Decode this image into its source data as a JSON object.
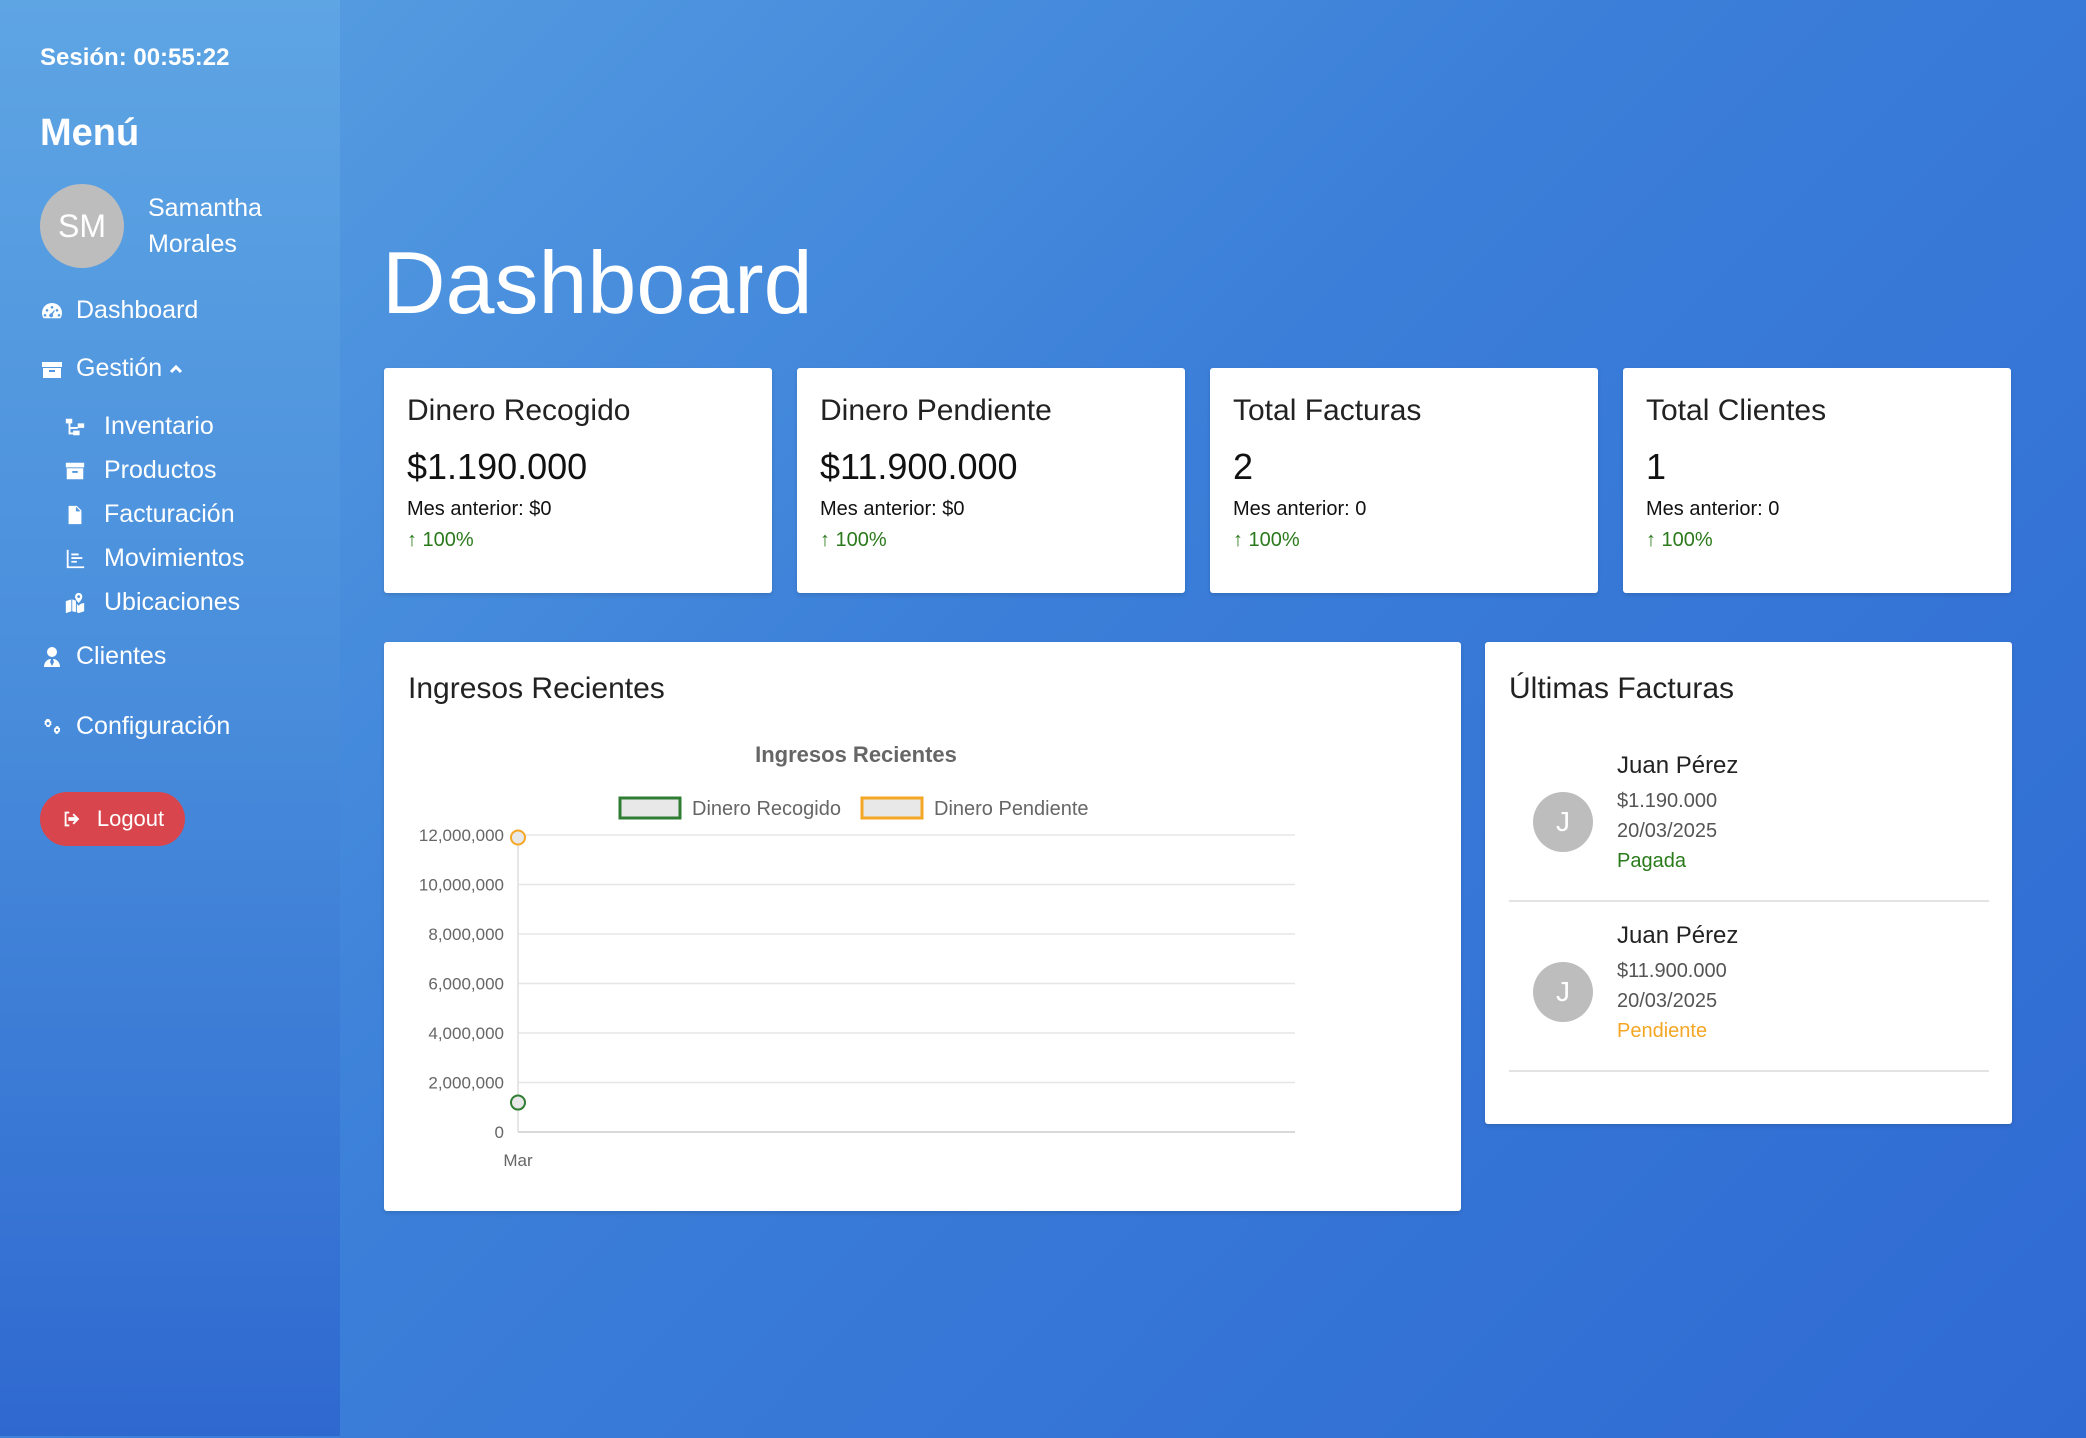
{
  "session": "Sesión: 00:55:22",
  "sidebar": {
    "menu_title": "Menú",
    "user": {
      "initials": "SM",
      "first_name": "Samantha",
      "last_name": "Morales"
    },
    "items": [
      {
        "label": "Dashboard",
        "icon": "gauge-icon"
      },
      {
        "label": "Gestión",
        "icon": "box-icon"
      },
      {
        "label": "Inventario",
        "icon": "sitemap-icon"
      },
      {
        "label": "Productos",
        "icon": "archive-icon"
      },
      {
        "label": "Facturación",
        "icon": "invoice-icon"
      },
      {
        "label": "Movimientos",
        "icon": "chart-list-icon"
      },
      {
        "label": "Ubicaciones",
        "icon": "map-location-icon"
      },
      {
        "label": "Clientes",
        "icon": "user-tie-icon"
      },
      {
        "label": "Configuración",
        "icon": "gears-icon"
      }
    ],
    "logout_label": "Logout"
  },
  "page_title": "Dashboard",
  "stats": [
    {
      "title": "Dinero Recogido",
      "value": "$1.190.000",
      "prev": "Mes anterior: $0",
      "change": "↑ 100%"
    },
    {
      "title": "Dinero Pendiente",
      "value": "$11.900.000",
      "prev": "Mes anterior: $0",
      "change": "↑ 100%"
    },
    {
      "title": "Total Facturas",
      "value": "2",
      "prev": "Mes anterior: 0",
      "change": "↑ 100%"
    },
    {
      "title": "Total Clientes",
      "value": "1",
      "prev": "Mes anterior: 0",
      "change": "↑ 100%"
    }
  ],
  "chart_card_title": "Ingresos Recientes",
  "chart_data": {
    "type": "line",
    "title": "Ingresos Recientes",
    "categories": [
      "Mar"
    ],
    "series": [
      {
        "name": "Dinero Recogido",
        "values": [
          1190000
        ],
        "color": "#2e7d32"
      },
      {
        "name": "Dinero Pendiente",
        "values": [
          11900000
        ],
        "color": "#f5a623"
      }
    ],
    "yticks": [
      "0",
      "2,000,000",
      "4,000,000",
      "6,000,000",
      "8,000,000",
      "10,000,000",
      "12,000,000"
    ],
    "ylim": [
      0,
      12000000
    ],
    "legend": "top",
    "grid": true
  },
  "invoices": {
    "title": "Últimas Facturas",
    "items": [
      {
        "initial": "J",
        "name": "Juan Pérez",
        "amount": "$1.190.000",
        "date": "20/03/2025",
        "status": "Pagada",
        "status_color": "#2a7a1b"
      },
      {
        "initial": "J",
        "name": "Juan Pérez",
        "amount": "$11.900.000",
        "date": "20/03/2025",
        "status": "Pendiente",
        "status_color": "#f5a623"
      }
    ]
  }
}
